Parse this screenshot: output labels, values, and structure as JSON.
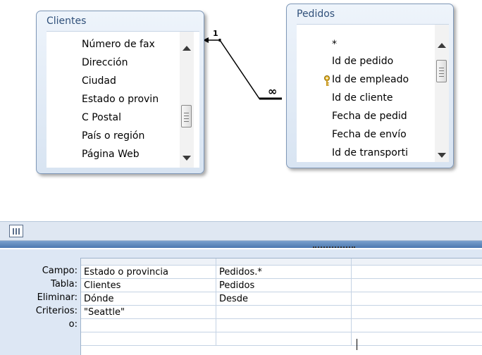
{
  "tables": {
    "clientes": {
      "title": "Clientes",
      "fields": [
        "Número de fax",
        "Dirección",
        "Ciudad",
        "Estado o provin",
        "C Postal",
        "País o región",
        "Página Web"
      ]
    },
    "pedidos": {
      "title": "Pedidos",
      "fields": [
        "*",
        "Id de pedido",
        "Id de empleado",
        "Id de cliente",
        "Fecha de pedid",
        "Fecha de envío",
        "Id de transporti"
      ]
    }
  },
  "relationship": {
    "one_label": "1",
    "many_label": "∞"
  },
  "grid": {
    "row_labels": [
      "Campo:",
      "Tabla:",
      "Eliminar:",
      "Criterios:",
      "o:"
    ],
    "columns": [
      {
        "campo": "Estado o provincia",
        "tabla": "Clientes",
        "eliminar": "Dónde",
        "criterios": "\"Seattle\"",
        "o": ""
      },
      {
        "campo": "Pedidos.*",
        "tabla": "Pedidos",
        "eliminar": "Desde",
        "criterios": "",
        "o": ""
      },
      {
        "campo": "",
        "tabla": "",
        "eliminar": "",
        "criterios": "",
        "o": ""
      }
    ]
  }
}
